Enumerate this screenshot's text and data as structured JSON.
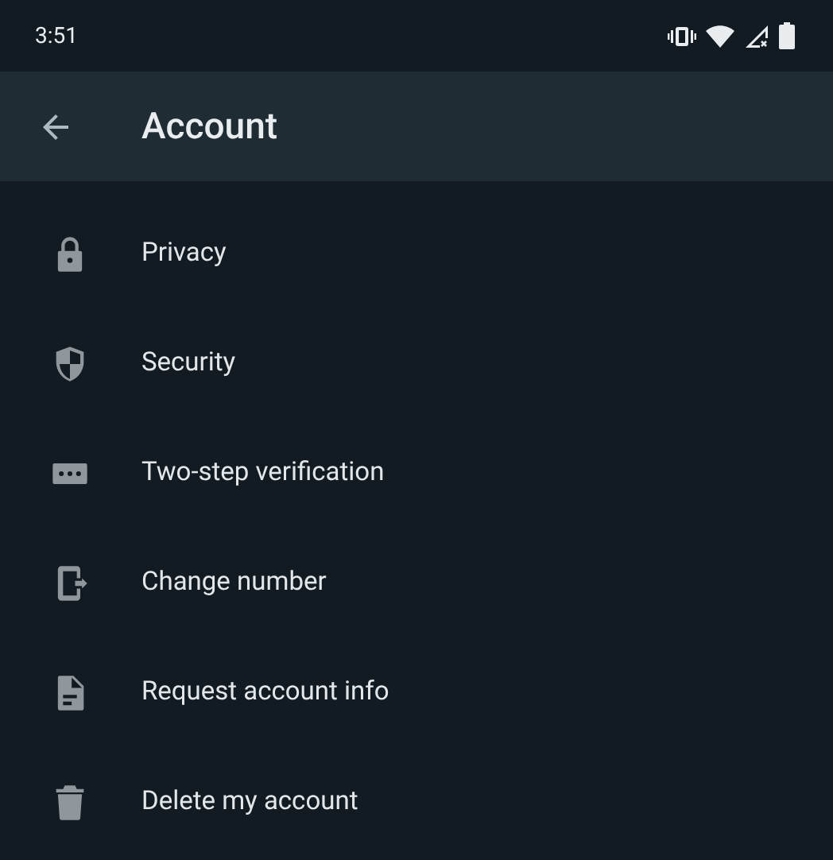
{
  "status_bar": {
    "time": "3:51"
  },
  "app_bar": {
    "title": "Account"
  },
  "items": [
    {
      "kind": "lock",
      "label": "Privacy"
    },
    {
      "kind": "shield",
      "label": "Security"
    },
    {
      "kind": "dots",
      "label": "Two-step verification"
    },
    {
      "kind": "phone",
      "label": "Change number"
    },
    {
      "kind": "document",
      "label": "Request account info"
    },
    {
      "kind": "trash",
      "label": "Delete my account"
    }
  ]
}
